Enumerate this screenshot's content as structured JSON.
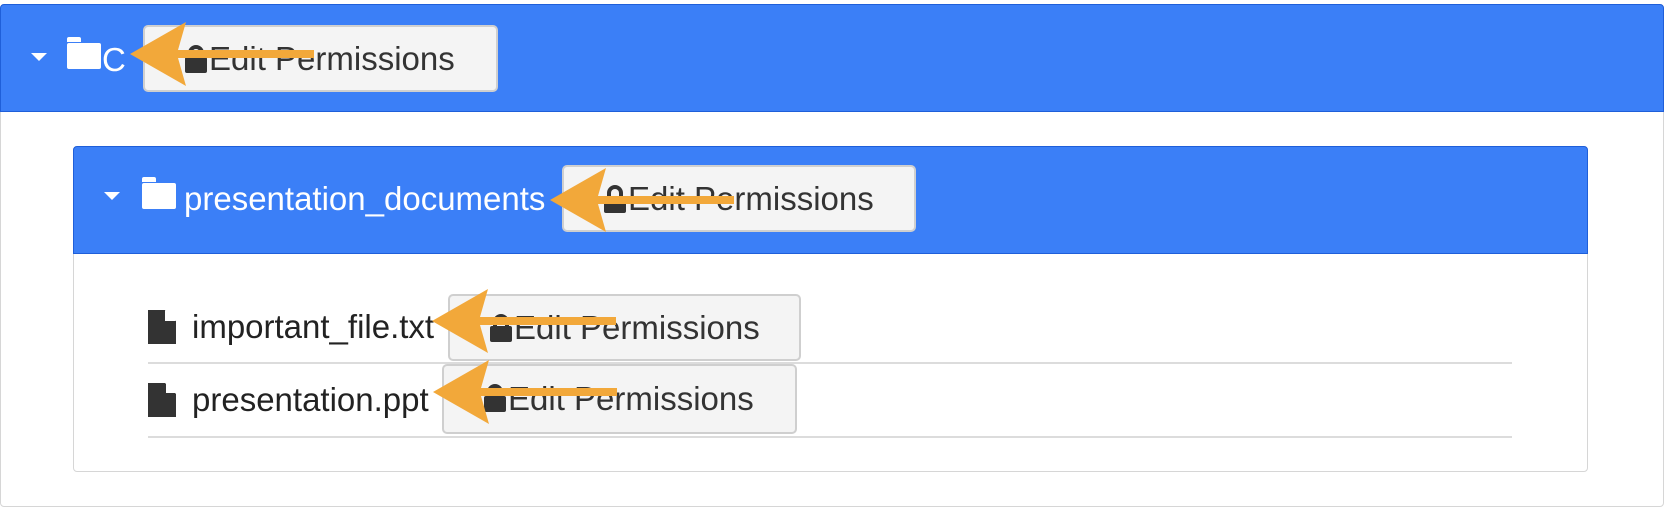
{
  "root": {
    "folder_name": "C",
    "button_label": "Edit Permissions"
  },
  "subfolder": {
    "folder_name": "presentation_documents",
    "button_label": "Edit Permissions"
  },
  "files": [
    {
      "name": "important_file.txt",
      "button_label": "Edit Permissions"
    },
    {
      "name": "presentation.ppt",
      "button_label": "Edit Permissions"
    }
  ],
  "colors": {
    "header_blue": "#3b7ff7",
    "annotation_arrow": "#f2a83a"
  },
  "icons": {
    "collapse": "caret-down-icon",
    "folder": "folder-icon",
    "lock": "lock-icon",
    "file": "file-icon",
    "annotation": "arrow-left-icon"
  }
}
